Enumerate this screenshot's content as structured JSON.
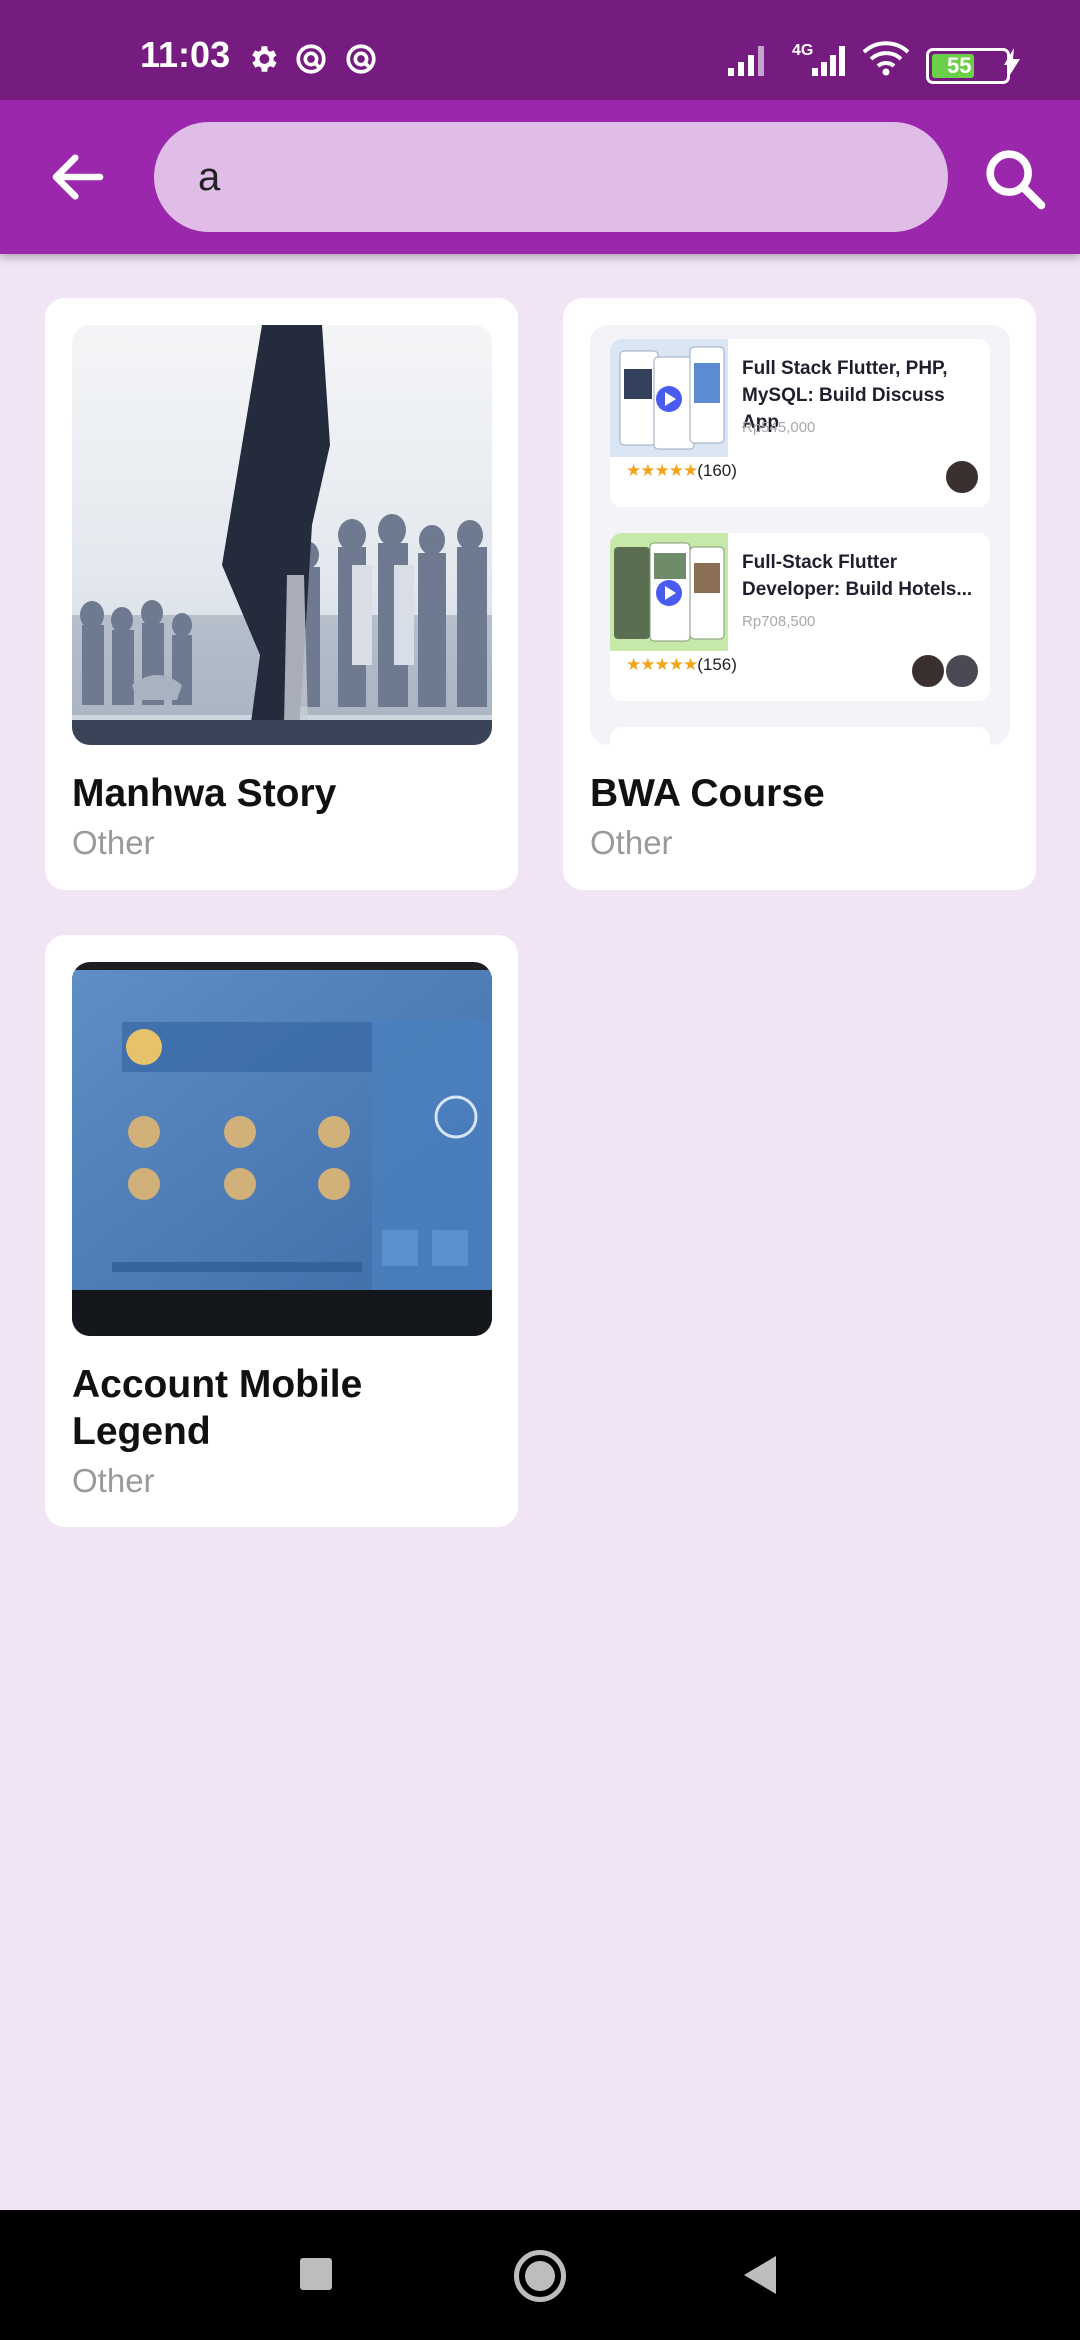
{
  "status_bar": {
    "time": "11:03",
    "network": "4G",
    "battery": "55"
  },
  "app_bar": {
    "search_value": "a"
  },
  "results": [
    {
      "title": "Manhwa Story",
      "category": "Other"
    },
    {
      "title": "BWA Course",
      "category": "Other"
    },
    {
      "title": "Account Mobile Legend",
      "category": "Other"
    }
  ],
  "bwa_thumbnail": {
    "courses": [
      {
        "title": "Full Stack Flutter, PHP, MySQL: Build Discuss App",
        "price": "Rp545,000",
        "rating": "(160)"
      },
      {
        "title": "Full-Stack Flutter Developer: Build Hotels...",
        "price": "Rp708,500",
        "rating": "(156)"
      }
    ]
  },
  "colors": {
    "status_bar": "#761c80",
    "app_bar": "#9a27ac",
    "search_field": "#dfbde6",
    "background": "#f1e4f5"
  }
}
